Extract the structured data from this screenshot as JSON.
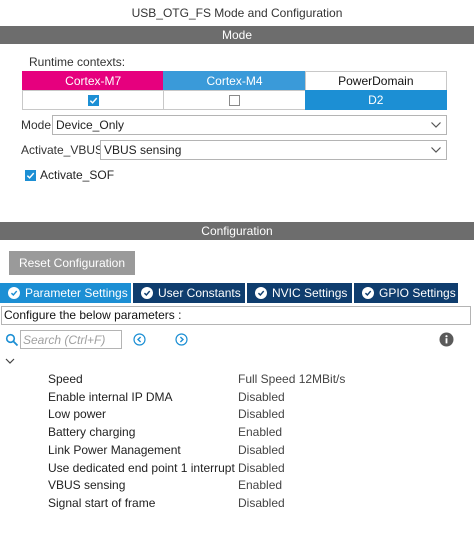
{
  "window": {
    "title": "USB_OTG_FS Mode and Configuration"
  },
  "mode_section": {
    "header": "Mode",
    "runtime_label": "Runtime contexts:",
    "contexts": [
      {
        "label": "Cortex-M7",
        "checked": true,
        "color": "#e6007e"
      },
      {
        "label": "Cortex-M4",
        "checked": false,
        "color": "#3a9ad9"
      },
      {
        "label": "PowerDomain",
        "value": "D2",
        "color": "#1c8fd4"
      }
    ],
    "mode": {
      "label": "Mode",
      "value": "Device_Only"
    },
    "activate_vbus": {
      "label": "Activate_VBUS",
      "value": "VBUS sensing"
    },
    "activate_sof": {
      "label": "Activate_SOF",
      "checked": true
    }
  },
  "config_section": {
    "header": "Configuration",
    "reset_button": "Reset Configuration",
    "tabs": [
      {
        "label": "Parameter Settings",
        "active": true
      },
      {
        "label": "User Constants",
        "active": false
      },
      {
        "label": "NVIC Settings",
        "active": false
      },
      {
        "label": "GPIO Settings",
        "active": false
      }
    ],
    "hint": "Configure the below parameters :",
    "search": {
      "placeholder": "Search (Ctrl+F)"
    },
    "parameters": [
      {
        "name": "Speed",
        "value": "Full Speed 12MBit/s"
      },
      {
        "name": "Enable internal IP DMA",
        "value": "Disabled"
      },
      {
        "name": "Low power",
        "value": "Disabled"
      },
      {
        "name": "Battery charging",
        "value": "Enabled"
      },
      {
        "name": "Link Power Management",
        "value": "Disabled"
      },
      {
        "name": "Use dedicated end point 1 interrupt",
        "value": "Disabled"
      },
      {
        "name": "VBUS sensing",
        "value": "Enabled"
      },
      {
        "name": "Signal start of frame",
        "value": "Disabled"
      }
    ]
  },
  "colors": {
    "section_bar": "#6d6d6d",
    "tab_active": "#1c8fd4",
    "tab_inactive": "#0f3d6e",
    "reset_button": "#9a9a9a"
  }
}
